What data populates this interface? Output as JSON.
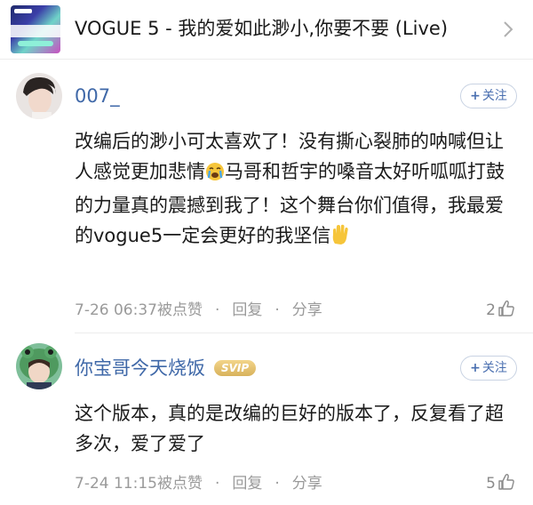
{
  "header": {
    "title": "VOGUE 5 - 我的爱如此渺小,你要不要 (Live)",
    "chevron_icon": "chevron-right-icon"
  },
  "comments": [
    {
      "username": "007_",
      "badge": "",
      "follow_label": "关注",
      "text": "改编后的渺小可太喜欢了！没有撕心裂肺的呐喊但让人感觉更加悲情",
      "emoji1": "crying-face-emoji",
      "text_b": "马哥和哲宇的嗓音太好听呱呱打鼓的力量真的震撼到我了！这个舞台你们值得，我最爱的vogue5一定会更好的我坚信",
      "emoji2": "raised-hand-emoji",
      "time": "7-26 06:37",
      "liked_by": "被点赞",
      "reply": "回复",
      "share": "分享",
      "likes": "2"
    },
    {
      "username": "你宝哥今天烧饭",
      "badge": "SVIP",
      "follow_label": "关注",
      "text": "这个版本，真的是改编的巨好的版本了，反复看了超多次，爱了爱了",
      "time": "7-24 11:15",
      "liked_by": "被点赞",
      "reply": "回复",
      "share": "分享",
      "likes": "5"
    }
  ],
  "colors": {
    "username": "#3f68a8",
    "meta": "#9a9a9a",
    "svip_gold": "#d8b25c"
  }
}
